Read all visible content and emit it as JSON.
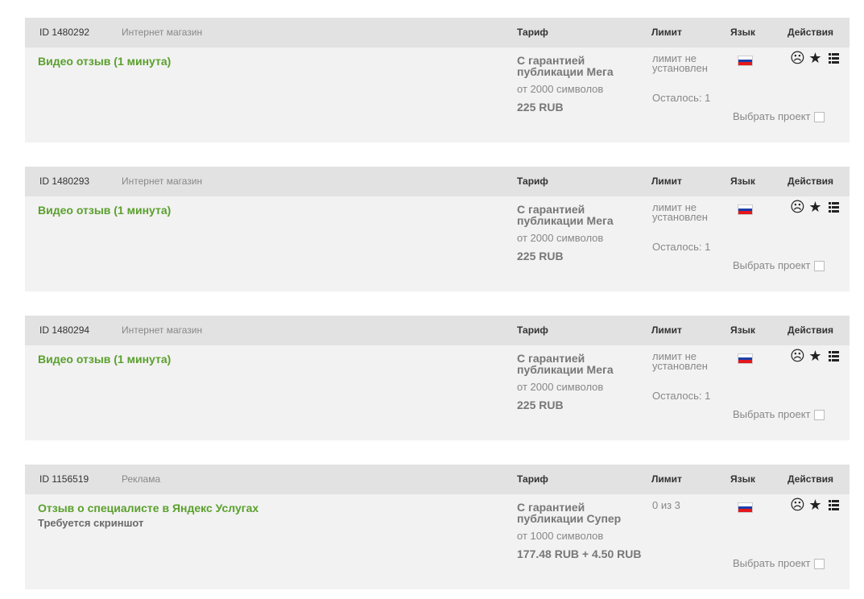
{
  "headers": {
    "tarif": "Тариф",
    "limit": "Лимит",
    "lang": "Язык",
    "actions": "Действия"
  },
  "flag_colors": [
    "#ffffff",
    "#1c3faa",
    "#e4181c"
  ],
  "accent_color": "#5aa02c",
  "choose_label": "Выбрать проект",
  "icons": [
    "sad-face-icon",
    "star-icon",
    "list-icon"
  ],
  "tasks": [
    {
      "id": "ID 1480292",
      "category": "Интернет магазин",
      "title": "Видео отзыв (1 минута)",
      "note": "",
      "tarif": "С гарантией публикации Мега",
      "min_chars": "от 2000 символов",
      "price": "225 RUB",
      "limit": "лимит не установлен",
      "remaining": "Осталось: 1"
    },
    {
      "id": "ID 1480293",
      "category": "Интернет магазин",
      "title": "Видео отзыв (1 минута)",
      "note": "",
      "tarif": "С гарантией публикации Мега",
      "min_chars": "от 2000 символов",
      "price": "225 RUB",
      "limit": "лимит не установлен",
      "remaining": "Осталось: 1"
    },
    {
      "id": "ID 1480294",
      "category": "Интернет магазин",
      "title": "Видео отзыв (1 минута)",
      "note": "",
      "tarif": "С гарантией публикации Мега",
      "min_chars": "от 2000 символов",
      "price": "225 RUB",
      "limit": "лимит не установлен",
      "remaining": "Осталось: 1"
    },
    {
      "id": "ID 1156519",
      "category": "Реклама",
      "title": "Отзыв о специалисте в Яндекс Услугах",
      "note": "Требуется скриншот",
      "tarif": "С гарантией публикации Супер",
      "min_chars": "от 1000 символов",
      "price": "177.48 RUB + 4.50 RUB",
      "limit": "0 из 3",
      "remaining": ""
    }
  ]
}
